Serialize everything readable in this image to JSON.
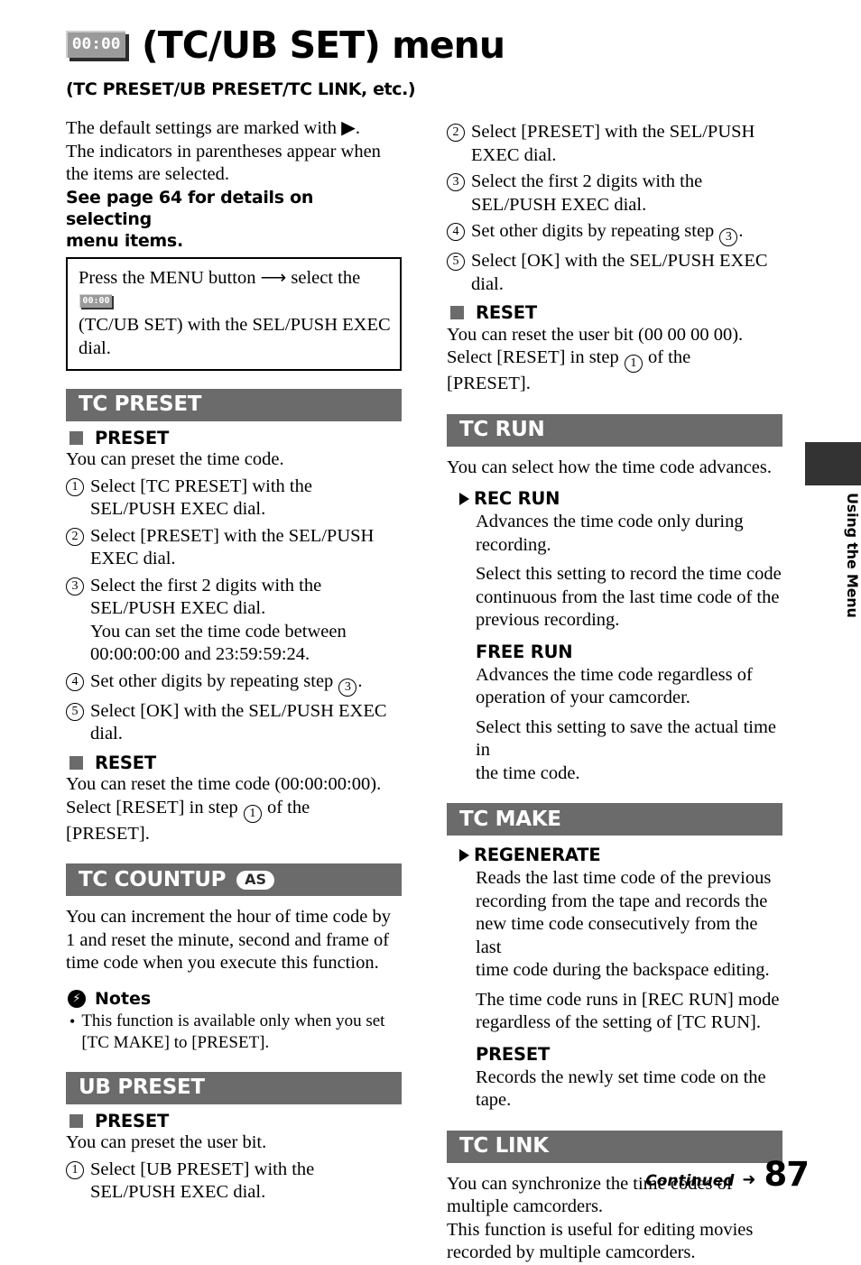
{
  "header": {
    "icon_digits": "00:00",
    "icon_name": "tc-ub-set-icon",
    "title": "(TC/UB SET) menu",
    "subtitle": "(TC PRESET/UB PRESET/TC LINK, etc.)"
  },
  "intro": {
    "line1": "The default settings are marked with ▶.",
    "line2": "The indicators in parentheses appear when",
    "line3": "the items are selected.",
    "bold_line1": "See page 64 for details on selecting",
    "bold_line2": "menu items."
  },
  "menu_box": {
    "part1": "Press the MENU button",
    "arrow": "⟶",
    "part2": "select the",
    "icon_digits": "00:00",
    "line2": "(TC/UB SET) with the SEL/PUSH EXEC",
    "line3": "dial."
  },
  "sections": {
    "tc_preset": {
      "bar_title": "TC PRESET",
      "preset": {
        "sub_title": "PRESET",
        "intro": "You can preset the time code.",
        "steps": [
          {
            "num": "1",
            "text": "Select [TC PRESET] with the SEL/PUSH EXEC dial."
          },
          {
            "num": "2",
            "text": "Select [PRESET] with the SEL/PUSH EXEC dial."
          },
          {
            "num": "3",
            "text": "Select the first 2 digits with the SEL/PUSH EXEC dial."
          }
        ],
        "step3_sub_line1": "You can set the time code between",
        "step3_sub_line2": "00:00:00:00 and 23:59:59:24.",
        "step4_pre": "Set other digits by repeating step",
        "step4_ref": "3",
        "step4_post": ".",
        "step4_num": "4",
        "step5_num": "5",
        "step5_text": "Select [OK] with the SEL/PUSH EXEC dial."
      },
      "reset": {
        "sub_title": "RESET",
        "line1": "You can reset the time code (00:00:00:00).",
        "line2_pre": "Select [RESET] in step",
        "line2_ref": "1",
        "line2_post": "of the",
        "line3": "[PRESET]."
      }
    },
    "tc_countup": {
      "bar_title": "TC COUNTUP",
      "badge": "AS",
      "line1": "You can increment the hour of time code by",
      "line2": "1 and reset the minute, second and frame of",
      "line3": "time code when you execute this function.",
      "notes_title": "Notes",
      "note1_line1": "This function is available only when you set",
      "note1_line2": "[TC MAKE] to [PRESET].",
      "bullet": "•"
    },
    "ub_preset": {
      "bar_title": "UB PRESET",
      "preset": {
        "sub_title": "PRESET",
        "intro": "You can preset the user bit.",
        "steps": [
          {
            "num": "1",
            "text": "Select [UB PRESET] with the SEL/PUSH EXEC dial."
          },
          {
            "num": "2",
            "text": "Select [PRESET] with the SEL/PUSH EXEC dial."
          },
          {
            "num": "3",
            "text": "Select the first 2 digits with the SEL/PUSH EXEC dial."
          }
        ],
        "step4_num": "4",
        "step4_pre": "Set other digits by repeating step",
        "step4_ref": "3",
        "step4_post": ".",
        "step5_num": "5",
        "step5_text": "Select [OK] with the SEL/PUSH EXEC dial."
      },
      "reset": {
        "sub_title": "RESET",
        "line1": "You can reset the user bit (00 00 00 00).",
        "line2_pre": "Select [RESET] in step",
        "line2_ref": "1",
        "line2_post": "of the",
        "line3": "[PRESET]."
      }
    },
    "tc_run": {
      "bar_title": "TC RUN",
      "intro": "You can select how the time code advances.",
      "rec_run": {
        "title": "REC RUN",
        "body1_line1": "Advances the time code only during",
        "body1_line2": "recording.",
        "body2_line1": "Select this setting to record the time code",
        "body2_line2": "continuous from the last time code of the",
        "body2_line3": "previous recording."
      },
      "free_run": {
        "title": "FREE RUN",
        "body1_line1": "Advances the time code regardless of",
        "body1_line2": "operation of your camcorder.",
        "body2_line1": "Select this setting to save the actual time in",
        "body2_line2": "the time code."
      }
    },
    "tc_make": {
      "bar_title": "TC MAKE",
      "regenerate": {
        "title": "REGENERATE",
        "body1_line1": "Reads the last time code of the previous",
        "body1_line2": "recording from the tape and records the",
        "body1_line3": "new time code consecutively from the last",
        "body1_line4": "time code during the backspace editing.",
        "body2_line1": "The time code runs in [REC RUN] mode",
        "body2_line2": "regardless of the setting of [TC RUN]."
      },
      "preset": {
        "title": "PRESET",
        "body_line1": "Records the newly set time code on the",
        "body_line2": "tape."
      }
    },
    "tc_link": {
      "bar_title": "TC LINK",
      "line1": "You can synchronize the time codes of",
      "line2": "multiple camcorders.",
      "line3": "This function is useful for editing movies",
      "line4": "recorded by multiple camcorders."
    }
  },
  "side_tab": {
    "label": "Using the Menu"
  },
  "footer": {
    "continued": "Continued",
    "arrow": "➜",
    "page_number": "87"
  },
  "colors": {
    "section_bar": "#6b6b6b",
    "side_tab": "#333333",
    "bullet_square": "#6b6b6b",
    "icon_face": "#9a9a9a"
  }
}
